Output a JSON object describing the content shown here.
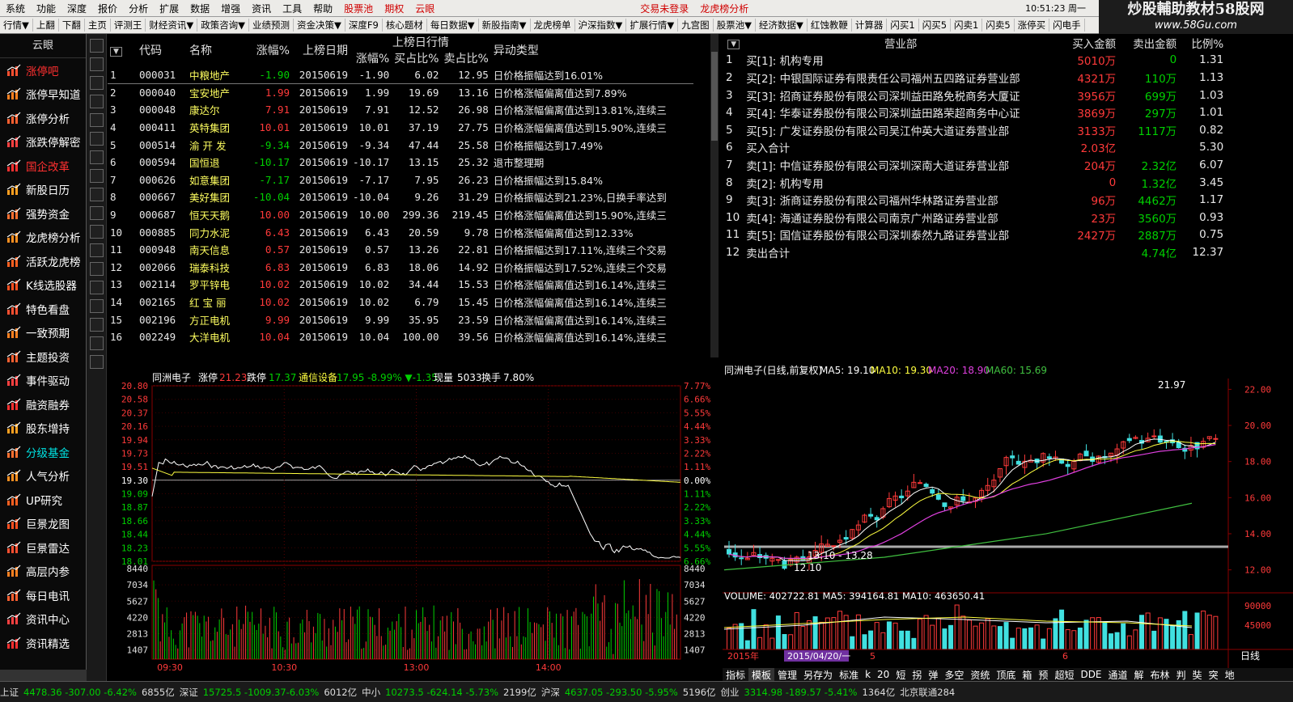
{
  "menubar": {
    "items": [
      "系统",
      "功能",
      "深度",
      "报价",
      "分析",
      "扩展",
      "数据",
      "增强",
      "资讯",
      "工具",
      "帮助"
    ],
    "red_items": [
      "股票池",
      "期权",
      "云眼"
    ],
    "login": "交易未登录",
    "dragon": "龙虎榜分析",
    "clock": "10:51:23 周一"
  },
  "toolbar": {
    "items": [
      "行情▼",
      "上翻",
      "下翻",
      "主页",
      "评测王",
      "财经资讯▼",
      "政策咨询▼",
      "业绩预测",
      "资金决策▼",
      "深度F9",
      "核心题材",
      "每日数据▼",
      "新股指南▼",
      "龙虎榜单",
      "沪深指数▼",
      "扩展行情▼",
      "九宫图",
      "股票池▼",
      "经济数据▼",
      "红蚀教鞭",
      "计算器",
      "闪买1",
      "闪买5",
      "闪卖1",
      "闪卖5",
      "涨停买",
      "闪电手"
    ]
  },
  "watermark": {
    "line1": "炒股輔助教材58股网",
    "line2": "www.58Gu.com"
  },
  "sidebar": {
    "title": "云眼",
    "items": [
      {
        "label": "涨停吧",
        "cls": "red",
        "icon": "chart-icon"
      },
      {
        "label": "涨停早知道",
        "cls": "",
        "icon": "clock-icon"
      },
      {
        "label": "涨停分析",
        "cls": "",
        "icon": "gauge-icon"
      },
      {
        "label": "涨跌停解密",
        "cls": "",
        "icon": "line-icon"
      },
      {
        "label": "国企改革",
        "cls": "red",
        "icon": "gear-icon"
      },
      {
        "label": "新股日历",
        "cls": "",
        "icon": "money-icon"
      },
      {
        "label": "强势资金",
        "cls": "",
        "icon": "coin-icon"
      },
      {
        "label": "龙虎榜分析",
        "cls": "",
        "icon": "briefcase-icon"
      },
      {
        "label": "活跃龙虎榜",
        "cls": "",
        "icon": "people-icon"
      },
      {
        "label": "K线选股器",
        "cls": "",
        "icon": "candle-icon"
      },
      {
        "label": "特色看盘",
        "cls": "",
        "icon": "trend-icon"
      },
      {
        "label": "一致预期",
        "cls": "",
        "icon": "bars-icon"
      },
      {
        "label": "主题投资",
        "cls": "",
        "icon": "gift-icon"
      },
      {
        "label": "事件驱动",
        "cls": "",
        "icon": "drive-icon"
      },
      {
        "label": "融资融券",
        "cls": "",
        "icon": "wallet-icon"
      },
      {
        "label": "股东增持",
        "cls": "",
        "icon": "share-icon"
      },
      {
        "label": "分级基金",
        "cls": "cy",
        "icon": "fund-icon"
      },
      {
        "label": "人气分析",
        "cls": "",
        "icon": "star-icon"
      },
      {
        "label": "UP研究",
        "cls": "",
        "icon": "up-icon"
      },
      {
        "label": "巨景龙图",
        "cls": "",
        "icon": "dragon-icon"
      },
      {
        "label": "巨景雷达",
        "cls": "",
        "icon": "radar-icon"
      },
      {
        "label": "高层内参",
        "cls": "",
        "icon": "doc-icon"
      },
      {
        "label": "每日电讯",
        "cls": "",
        "icon": "news-icon"
      },
      {
        "label": "资讯中心",
        "cls": "",
        "icon": "info-icon"
      },
      {
        "label": "资讯精选",
        "cls": "",
        "icon": "select-icon"
      }
    ]
  },
  "table1": {
    "header_group": "上榜日行情",
    "headers": [
      "",
      "代码",
      "名称",
      "涨幅%",
      "上榜日期",
      "涨幅%",
      "买占比%",
      "卖占比%",
      "异动类型"
    ],
    "rows": [
      [
        "1",
        "000031",
        "中粮地产",
        "-1.90",
        "20150619",
        "-1.90",
        "6.02",
        "12.95",
        "日价格振幅达到16.01%"
      ],
      [
        "2",
        "000040",
        "宝安地产",
        "1.99",
        "20150619",
        "1.99",
        "19.69",
        "13.16",
        "日价格涨幅偏离值达到7.89%"
      ],
      [
        "3",
        "000048",
        "康达尔",
        "7.91",
        "20150619",
        "7.91",
        "12.52",
        "26.98",
        "日价格涨幅偏离值达到13.81%,连续三"
      ],
      [
        "4",
        "000411",
        "英特集团",
        "10.01",
        "20150619",
        "10.01",
        "37.19",
        "27.75",
        "日价格涨幅偏离值达到15.90%,连续三"
      ],
      [
        "5",
        "000514",
        "渝 开 发",
        "-9.34",
        "20150619",
        "-9.34",
        "47.44",
        "25.58",
        "日价格振幅达到17.49%"
      ],
      [
        "6",
        "000594",
        "国恒退",
        "-10.17",
        "20150619",
        "-10.17",
        "13.15",
        "25.32",
        "退市整理期"
      ],
      [
        "7",
        "000626",
        "如意集团",
        "-7.17",
        "20150619",
        "-7.17",
        "7.95",
        "26.23",
        "日价格振幅达到15.84%"
      ],
      [
        "8",
        "000667",
        "美好集团",
        "-10.04",
        "20150619",
        "-10.04",
        "9.26",
        "31.29",
        "日价格振幅达到21.23%,日换手率达到"
      ],
      [
        "9",
        "000687",
        "恒天天鹅",
        "10.00",
        "20150619",
        "10.00",
        "299.36",
        "219.45",
        "日价格涨幅偏离值达到15.90%,连续三"
      ],
      [
        "10",
        "000885",
        "同力水泥",
        "6.43",
        "20150619",
        "6.43",
        "20.59",
        "9.78",
        "日价格涨幅偏离值达到12.33%"
      ],
      [
        "11",
        "000948",
        "南天信息",
        "0.57",
        "20150619",
        "0.57",
        "13.26",
        "22.81",
        "日价格振幅达到17.11%,连续三个交易"
      ],
      [
        "12",
        "002066",
        "瑞泰科技",
        "6.83",
        "20150619",
        "6.83",
        "18.06",
        "14.92",
        "日价格振幅达到17.52%,连续三个交易"
      ],
      [
        "13",
        "002114",
        "罗平锌电",
        "10.02",
        "20150619",
        "10.02",
        "34.44",
        "15.53",
        "日价格涨幅偏离值达到16.14%,连续三"
      ],
      [
        "14",
        "002165",
        "红 宝 丽",
        "10.02",
        "20150619",
        "10.02",
        "6.79",
        "15.45",
        "日价格涨幅偏离值达到16.14%,连续三"
      ],
      [
        "15",
        "002196",
        "方正电机",
        "9.99",
        "20150619",
        "9.99",
        "35.95",
        "23.59",
        "日价格涨幅偏离值达到16.14%,连续三"
      ],
      [
        "16",
        "002249",
        "大洋电机",
        "10.04",
        "20150619",
        "10.04",
        "100.00",
        "39.56",
        "日价格涨幅偏离值达到16.14%,连续三"
      ]
    ]
  },
  "table2": {
    "headers": [
      "",
      "营业部",
      "买入金额",
      "卖出金额",
      "比例%"
    ],
    "rows": [
      [
        "1",
        "买[1]: 机构专用",
        "5010万",
        "0",
        "1.31"
      ],
      [
        "2",
        "买[2]: 中银国际证券有限责任公司福州五四路证券营业部",
        "4321万",
        "110万",
        "1.13"
      ],
      [
        "3",
        "买[3]: 招商证券股份有限公司深圳益田路免税商务大厦证",
        "3956万",
        "699万",
        "1.03"
      ],
      [
        "4",
        "买[4]: 华泰证券股份有限公司深圳益田路荣超商务中心证",
        "3869万",
        "297万",
        "1.01"
      ],
      [
        "5",
        "买[5]: 广发证券股份有限公司吴江仲英大道证券营业部",
        "3133万",
        "1117万",
        "0.82"
      ],
      [
        "6",
        "买入合计",
        "2.03亿",
        "",
        "5.30"
      ],
      [
        "7",
        "卖[1]: 中信证券股份有限公司深圳深南大道证券营业部",
        "204万",
        "2.32亿",
        "6.07"
      ],
      [
        "8",
        "卖[2]: 机构专用",
        "0",
        "1.32亿",
        "3.45"
      ],
      [
        "9",
        "卖[3]: 浙商证券股份有限公司福州华林路证券营业部",
        "96万",
        "4462万",
        "1.17"
      ],
      [
        "10",
        "卖[4]: 海通证券股份有限公司南京广州路证券营业部",
        "23万",
        "3560万",
        "0.93"
      ],
      [
        "11",
        "卖[5]: 国信证券股份有限公司深圳泰然九路证券营业部",
        "2427万",
        "2887万",
        "0.75"
      ],
      [
        "12",
        "卖出合计",
        "",
        "4.74亿",
        "12.37"
      ]
    ]
  },
  "intraday": {
    "name": "同洲电子",
    "zt_label": "涨停",
    "zt": "21.23",
    "dt_label": "跌停",
    "dt": "17.37",
    "sector": "通信设备",
    "sector_val": "17.95 -8.99% ▼-1.35",
    "vol_label": "现量",
    "vol": "5033",
    "turn_label": "换手",
    "turn": "7.80%",
    "left_ticks": [
      "20.80",
      "20.58",
      "20.37",
      "20.16",
      "19.94",
      "19.73",
      "19.51",
      "19.30",
      "19.09",
      "18.87",
      "18.66",
      "18.44",
      "18.23",
      "18.01"
    ],
    "right_ticks": [
      "7.77%",
      "6.66%",
      "5.55%",
      "4.44%",
      "3.33%",
      "2.22%",
      "1.11%",
      "0.00%",
      "1.11%",
      "2.22%",
      "3.33%",
      "4.44%",
      "5.55%",
      "6.66%"
    ],
    "vol_ticks": [
      "8440",
      "7034",
      "5627",
      "4220",
      "2813",
      "1407"
    ],
    "time_ticks": [
      "09:30",
      "10:30",
      "13:00",
      "14:00"
    ]
  },
  "kline": {
    "title": "同洲电子(日线,前复权)",
    "ma5": "MA5: 19.10",
    "ma10": "MA10: 19.30",
    "ma20": "MA20: 18.90",
    "ma60": "MA60: 15.69",
    "high_label": "21.97",
    "low_label": "12.10",
    "range_label": "13.10 - 13.28",
    "price_ticks": [
      "22.00",
      "20.00",
      "18.00",
      "16.00",
      "14.00",
      "12.00"
    ],
    "vol_header": "VOLUME: 402722.81  MA5: 394164.81  MA10: 463650.41",
    "vol_ticks": [
      "90000",
      "45000"
    ],
    "date_left": "2015年",
    "date_sel": "2015/04/20/一",
    "date_m1": "5",
    "date_m2": "6",
    "period": "日线"
  },
  "ktabs": [
    "指标",
    "模板",
    "管理",
    "另存为",
    "标准",
    "k",
    "20",
    "短",
    "拐",
    "弹",
    "多空",
    "资统",
    "顶底",
    "箱",
    "预",
    "超短",
    "DDE",
    "通道",
    "解",
    "布林",
    "判",
    "奘",
    "突",
    "地"
  ],
  "statusbar": [
    {
      "t": "上证",
      "c": "w"
    },
    {
      "t": "4478.36 -307.00 -6.42%",
      "c": "g"
    },
    {
      "t": "6855亿",
      "c": "w"
    },
    {
      "t": "深证",
      "c": "w"
    },
    {
      "t": "15725.5 -1009.37-6.03%",
      "c": "g"
    },
    {
      "t": "6012亿",
      "c": "w"
    },
    {
      "t": "中小",
      "c": "w"
    },
    {
      "t": "10273.5 -624.14 -5.73%",
      "c": "g"
    },
    {
      "t": "2199亿",
      "c": "w"
    },
    {
      "t": "沪深",
      "c": "w"
    },
    {
      "t": "4637.05 -293.50 -5.95%",
      "c": "g"
    },
    {
      "t": "5196亿",
      "c": "w"
    },
    {
      "t": "创业",
      "c": "w"
    },
    {
      "t": "3314.98 -189.57 -5.41%",
      "c": "g"
    },
    {
      "t": "1364亿",
      "c": "w"
    },
    {
      "t": "北京联通284",
      "c": "w"
    }
  ],
  "colors": {
    "up": "#ff3a3a",
    "down": "#00d000",
    "yellow": "#ffff40",
    "cyan": "#40e0e0",
    "magenta": "#e040e0",
    "green_line": "#40c040"
  }
}
